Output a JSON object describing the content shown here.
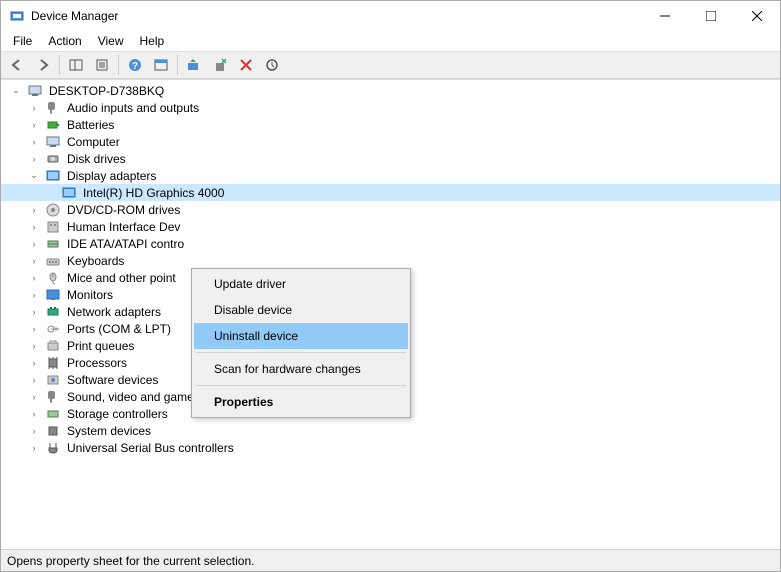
{
  "window": {
    "title": "Device Manager"
  },
  "menubar": {
    "items": [
      "File",
      "Action",
      "View",
      "Help"
    ]
  },
  "tree": {
    "root": "DESKTOP-D738BKQ",
    "categories": [
      {
        "label": "Audio inputs and outputs",
        "expanded": false
      },
      {
        "label": "Batteries",
        "expanded": false
      },
      {
        "label": "Computer",
        "expanded": false
      },
      {
        "label": "Disk drives",
        "expanded": false
      },
      {
        "label": "Display adapters",
        "expanded": true,
        "children": [
          {
            "label": "Intel(R) HD Graphics 4000",
            "selected": true
          }
        ]
      },
      {
        "label": "DVD/CD-ROM drives",
        "expanded": false
      },
      {
        "label": "Human Interface Dev",
        "expanded": false
      },
      {
        "label": "IDE ATA/ATAPI contro",
        "expanded": false
      },
      {
        "label": "Keyboards",
        "expanded": false
      },
      {
        "label": "Mice and other point",
        "expanded": false
      },
      {
        "label": "Monitors",
        "expanded": false
      },
      {
        "label": "Network adapters",
        "expanded": false
      },
      {
        "label": "Ports (COM & LPT)",
        "expanded": false
      },
      {
        "label": "Print queues",
        "expanded": false
      },
      {
        "label": "Processors",
        "expanded": false
      },
      {
        "label": "Software devices",
        "expanded": false
      },
      {
        "label": "Sound, video and game controllers",
        "expanded": false
      },
      {
        "label": "Storage controllers",
        "expanded": false
      },
      {
        "label": "System devices",
        "expanded": false
      },
      {
        "label": "Universal Serial Bus controllers",
        "expanded": false
      }
    ]
  },
  "context_menu": {
    "items": [
      {
        "label": "Update driver"
      },
      {
        "label": "Disable device"
      },
      {
        "label": "Uninstall device",
        "highlighted": true
      },
      {
        "separator": true
      },
      {
        "label": "Scan for hardware changes"
      },
      {
        "separator": true
      },
      {
        "label": "Properties",
        "bold": true
      }
    ]
  },
  "statusbar": {
    "text": "Opens property sheet for the current selection."
  }
}
